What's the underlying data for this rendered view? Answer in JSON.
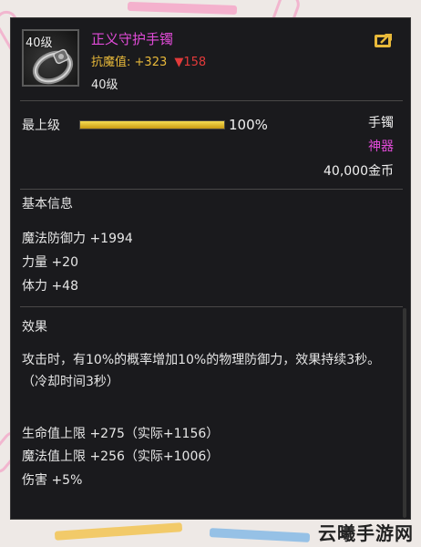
{
  "item": {
    "icon": "bracelet-icon",
    "level_badge": "40级",
    "name": "正义守护手镯",
    "resist_label": "抗魔值:",
    "resist_value": "+323",
    "resist_delta": "158",
    "level_text": "40级",
    "share_icon": "share-icon"
  },
  "summary": {
    "rank_label": "最上级",
    "progress": 1.0,
    "progress_text": "100%",
    "type": "手镯",
    "rarity": "神器",
    "price": "40,000金币"
  },
  "basic": {
    "title": "基本信息",
    "stats": [
      "魔法防御力 +1994",
      "力量 +20",
      "体力 +48"
    ]
  },
  "effect": {
    "title": "效果",
    "description": "攻击时，有10%的概率增加10%的物理防御力，效果持续3秒。（冷却时间3秒）",
    "stats": [
      "生命值上限 +275（实际+1156）",
      "魔法值上限 +256（实际+1006）",
      "伤害 +5%"
    ]
  },
  "watermark": "云曦手游网",
  "colors": {
    "panel_bg": "#1a1a1d",
    "name_purple": "#e14bd8",
    "resist_gold": "#e8b93a",
    "decrease_red": "#e23a3a",
    "progress_gold": "#f7de53"
  }
}
